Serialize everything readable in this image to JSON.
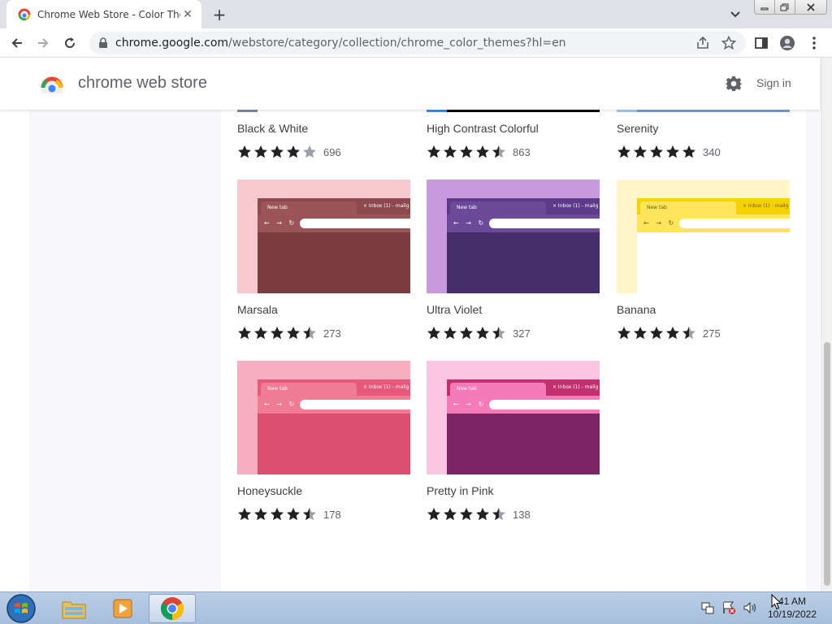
{
  "browser": {
    "tab_title": "Chrome Web Store - Color Them",
    "new_tab_label": "+",
    "url_host": "chrome.google.com",
    "url_path": "/webstore/category/collection/chrome_color_themes?hl=en"
  },
  "store": {
    "title": "chrome web store",
    "signin_label": "Sign in"
  },
  "themes": [
    {
      "name": "Black & White",
      "rating": 4.0,
      "count": "696",
      "colors": {
        "left": "#7f8aa3",
        "strip": "#7f8aa3",
        "body": "#ffffff",
        "tab": "#ffffff"
      }
    },
    {
      "name": "High Contrast Colorful",
      "rating": 4.5,
      "count": "863",
      "colors": {
        "left": "#3d8bff",
        "strip": "#000000",
        "body": "#000000",
        "tab": "#000000"
      }
    },
    {
      "name": "Serenity",
      "rating": 5.0,
      "count": "340",
      "colors": {
        "left": "#a8c8f0",
        "strip": "#7f9ccf",
        "body": "#7f9ccf",
        "tab": "#7f9ccf"
      }
    },
    {
      "name": "Marsala",
      "rating": 4.5,
      "count": "273",
      "colors": {
        "left": "#f7c9cf",
        "strip": "#8c4a4f",
        "body": "#7b3d40",
        "tab": "#9b5458",
        "text": "#ffffff"
      }
    },
    {
      "name": "Ultra Violet",
      "rating": 4.5,
      "count": "327",
      "colors": {
        "left": "#c79ae0",
        "strip": "#5e3a8a",
        "body": "#452c6a",
        "tab": "#6c4a9a",
        "text": "#ffffff"
      }
    },
    {
      "name": "Banana",
      "rating": 4.5,
      "count": "275",
      "colors": {
        "left": "#fff7c9",
        "strip": "#f5d200",
        "body": "#ffffff",
        "tab": "#ffe55c",
        "text": "#6b5d00"
      }
    },
    {
      "name": "Honeysuckle",
      "rating": 4.5,
      "count": "178",
      "colors": {
        "left": "#f7aebf",
        "strip": "#e8587a",
        "body": "#dd4e70",
        "tab": "#ef7b95",
        "text": "#ffffff"
      }
    },
    {
      "name": "Pretty in Pink",
      "rating": 4.5,
      "count": "138",
      "colors": {
        "left": "#fbc6e4",
        "strip": "#c3306f",
        "body": "#7d2466",
        "tab": "#f47ab8",
        "text": "#ffffff"
      }
    }
  ],
  "mock": {
    "tab_label": "New tab",
    "tab2_label": "Inbox (1) - mailg",
    "close_glyph": "×",
    "arrows": "← → ↻"
  },
  "taskbar": {
    "time": "41 AM",
    "date": "10/19/2022"
  },
  "icons": {
    "back": "arrow-left-icon",
    "forward": "arrow-right-icon",
    "reload": "reload-icon",
    "share": "share-icon",
    "bookmark": "star-outline-icon",
    "sidepanel": "side-panel-icon",
    "profile": "profile-icon",
    "menu": "kebab-menu-icon",
    "settings": "gear-icon"
  }
}
